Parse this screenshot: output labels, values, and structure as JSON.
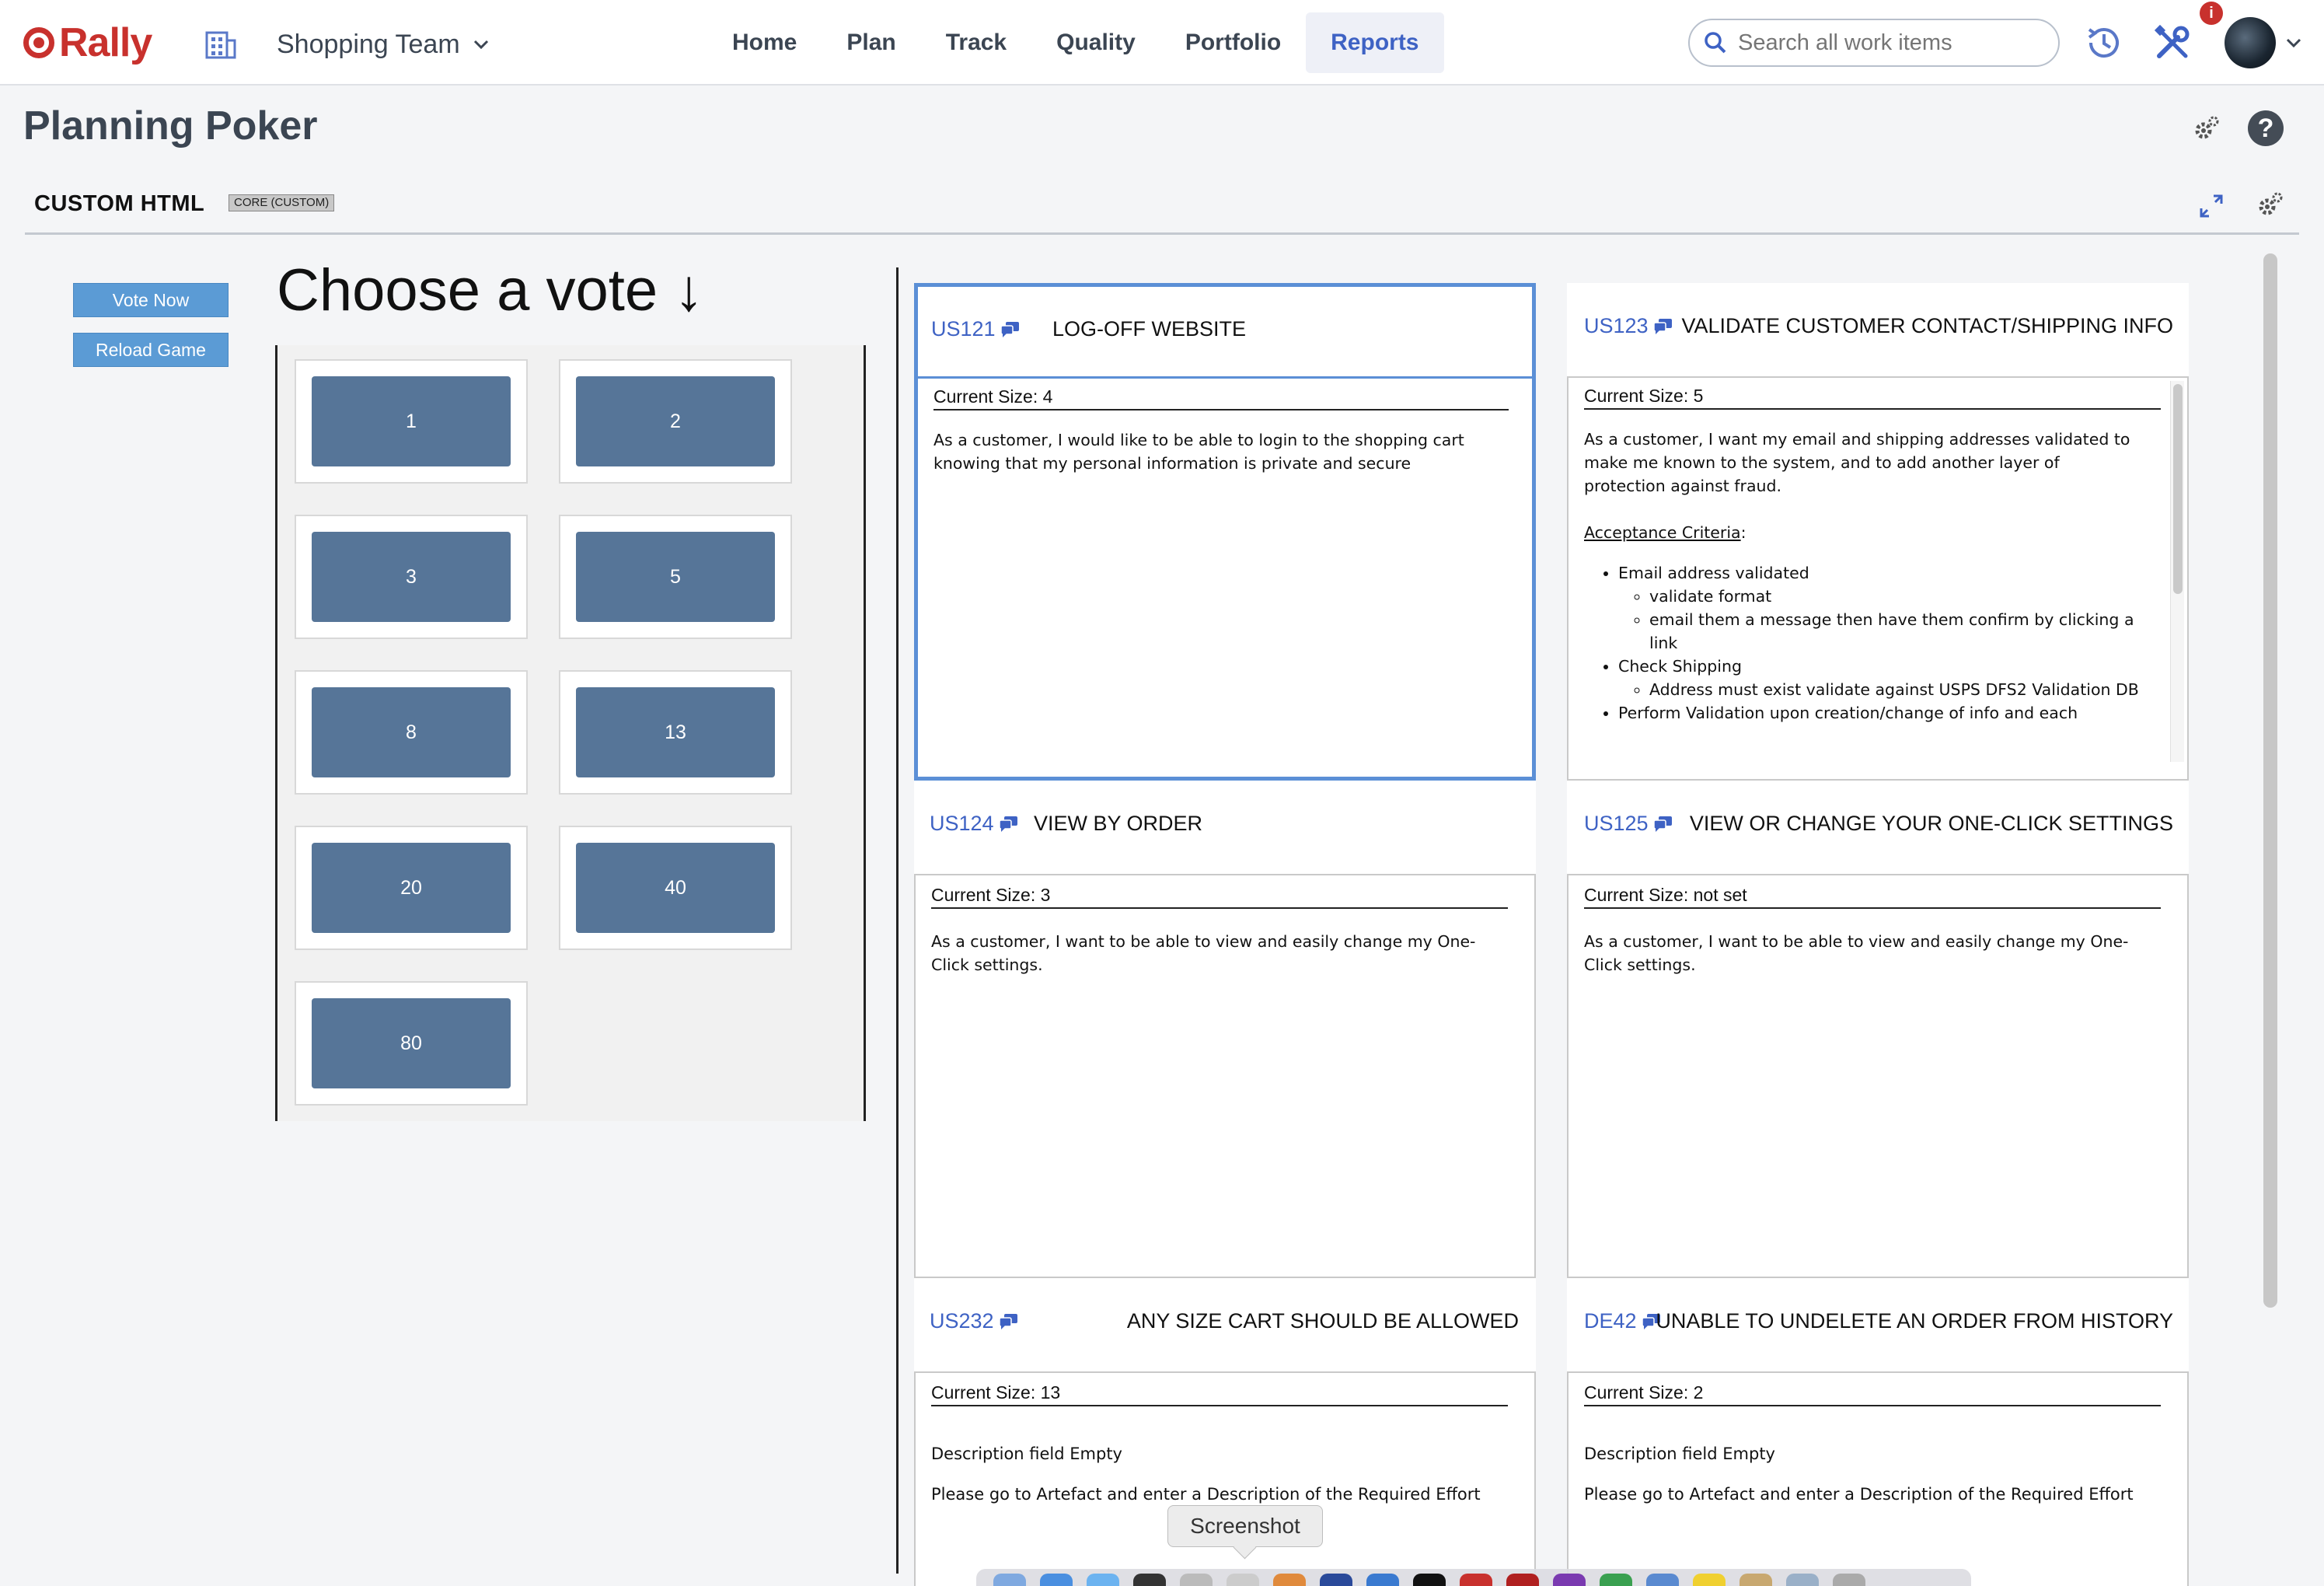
{
  "app": {
    "logo_text": "Rally",
    "brand_color": "#c8312d",
    "accent_color": "#3e62c4"
  },
  "topbar": {
    "workspace": "Shopping Team",
    "nav": [
      "Home",
      "Plan",
      "Track",
      "Quality",
      "Portfolio",
      "Reports"
    ],
    "active_nav": "Reports",
    "search_placeholder": "Search all work items",
    "notification_badge": "i",
    "icons": [
      "workspace-icon",
      "search-icon",
      "history-icon",
      "tools-icon",
      "avatar",
      "chevron-down-icon"
    ]
  },
  "page": {
    "title": "Planning Poker",
    "help_label": "?"
  },
  "panel": {
    "title": "CUSTOM HTML",
    "tag": "CORE (CUSTOM)"
  },
  "controls": {
    "vote_now": "Vote Now",
    "reload_game": "Reload Game"
  },
  "vote": {
    "heading": "Choose a vote ↓",
    "cards": [
      "1",
      "2",
      "3",
      "5",
      "8",
      "13",
      "20",
      "40",
      "80"
    ]
  },
  "stories": [
    {
      "id": "US121",
      "name": "LOG-OFF WEBSITE",
      "size": "Current Size: 4",
      "description": "As a customer, I would like to be able to login to the shopping cart knowing that my personal information is private and secure"
    },
    {
      "id": "US123",
      "name": "VALIDATE CUSTOMER CONTACT/SHIPPING INFO",
      "size": "Current Size: 5",
      "description": "As a customer, I want my email and shipping addresses validated to make me known to the system, and to add another layer of protection against fraud.",
      "criteria_label": "Acceptance Criteria",
      "criteria": [
        {
          "text": "Email address validated",
          "sub": [
            "validate format",
            "email them a message then have them confirm by clicking a link"
          ]
        },
        {
          "text": "Check Shipping",
          "sub": [
            "Address must exist validate against USPS DFS2 Validation DB"
          ]
        },
        {
          "text": "Perform Validation upon creation/change of info and each",
          "sub": []
        }
      ]
    },
    {
      "id": "US124",
      "name": "VIEW BY ORDER",
      "size": "Current Size: 3",
      "description": "As a customer, I want to be able to view and easily change my One-Click settings."
    },
    {
      "id": "US125",
      "name": "VIEW OR CHANGE YOUR ONE-CLICK SETTINGS",
      "size": "Current Size: not set",
      "description": "As a customer, I want to be able to view and easily change my One-Click settings."
    },
    {
      "id": "US232",
      "name": "ANY SIZE CART SHOULD BE ALLOWED",
      "size": "Current Size: 13",
      "empty_1": "Description field Empty",
      "empty_2": "Please go to Artefact and enter a Description of the Required Effort"
    },
    {
      "id": "DE42",
      "name": "UNABLE TO UNDELETE AN ORDER FROM HISTORY",
      "size": "Current Size: 2",
      "empty_1": "Description field Empty",
      "empty_2": "Please go to Artefact and enter a Description of the Required Effort"
    }
  ],
  "tooltip": "Screenshot"
}
